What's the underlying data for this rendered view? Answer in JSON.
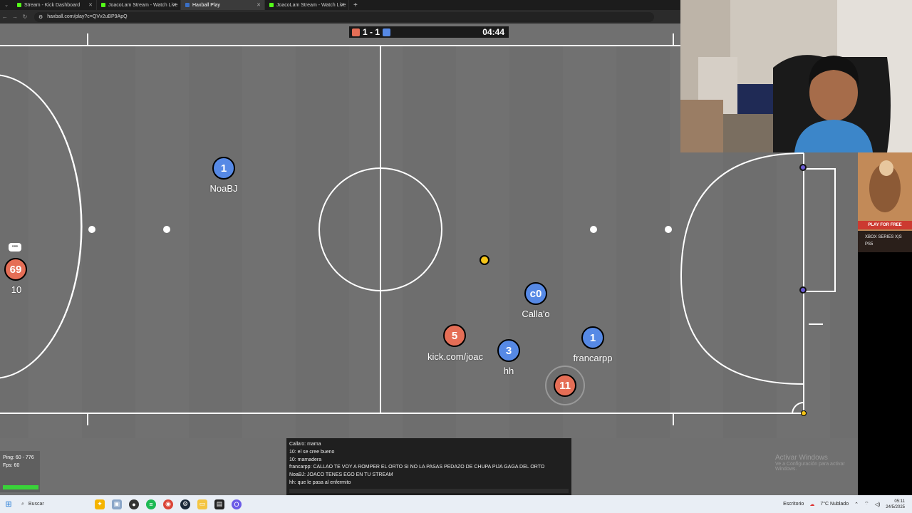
{
  "browser": {
    "tabs": [
      {
        "label": "Stream - Kick Dashboard",
        "color": "#53fc18",
        "active": false
      },
      {
        "label": "JoacoLam Stream - Watch Live",
        "color": "#53fc18",
        "active": false
      },
      {
        "label": "Haxball Play",
        "color": "#3a6fc4",
        "active": true
      },
      {
        "label": "JoacoLam Stream - Watch Live",
        "color": "#53fc18",
        "active": false
      }
    ],
    "url": "haxball.com/play?c=QVv2uBP9ApQ"
  },
  "scoreboard": {
    "score": "1 - 1",
    "time": "04:44",
    "red_color": "#e56e56",
    "blue_color": "#5689e5"
  },
  "players": [
    {
      "number": "1",
      "name": "NoaBJ",
      "team": "blue"
    },
    {
      "number": "69",
      "name": "10",
      "team": "red"
    },
    {
      "number": "c0",
      "name": "Calla'o",
      "team": "blue"
    },
    {
      "number": "5",
      "name": "kick.com/joac",
      "team": "red"
    },
    {
      "number": "3",
      "name": "hh",
      "team": "blue"
    },
    {
      "number": "1",
      "name": "francarpp",
      "team": "blue"
    },
    {
      "number": "11",
      "name": "",
      "team": "red"
    }
  ],
  "chat": [
    "Calla'o: mama",
    "10: el se cree bueno",
    "10: mamadera",
    "francarpp: CALLAO TE VOY A ROMPER EL ORTO SI NO LA PASAS PEDAZO DE CHUPA PIJA GAGA DEL ORTO",
    "NoaBJ: JOACO TENES EGO EN TU STREAM",
    "hh: que le pasa al enfermito"
  ],
  "stats": {
    "ping": "Ping: 60 - 776",
    "fps": "Fps: 60"
  },
  "watermark": {
    "title": "Activar Windows",
    "subtitle": "Ve a Configuración para activar Windows."
  },
  "ad": {
    "cta": "PLAY FOR FREE",
    "platform1": "XBOX SERIES X|S",
    "platform2": "PS5"
  },
  "taskbar": {
    "search": "Buscar",
    "desktop": "Escritorio",
    "weather": "7°C  Nublado",
    "time": "05:11",
    "date": "24/5/2025"
  }
}
